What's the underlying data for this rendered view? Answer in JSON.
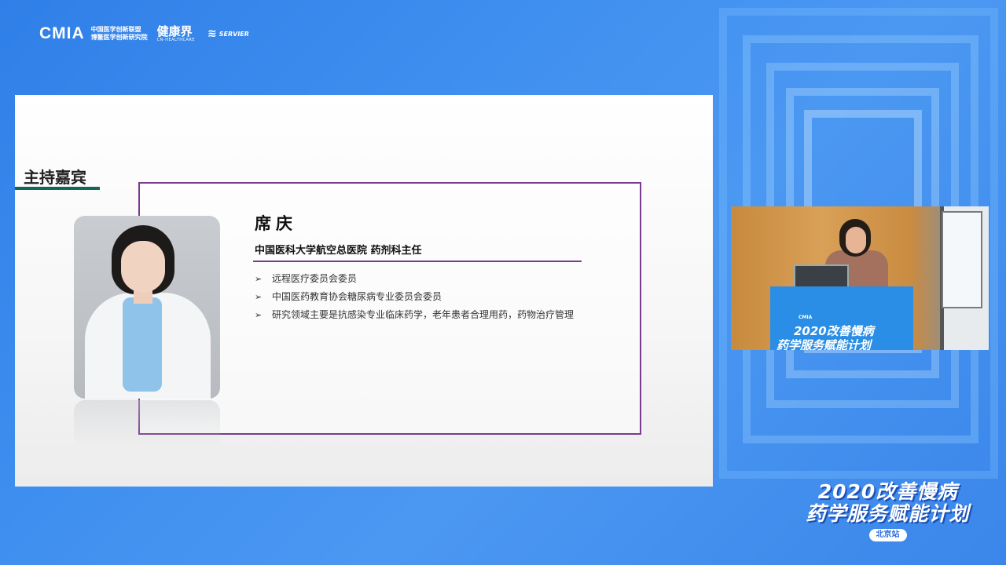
{
  "logos": {
    "cmia": "CMIA",
    "cmia_sub_line1": "中国医学创新联盟",
    "cmia_sub_line2": "博鳌医学创新研究院",
    "jkj_cn": "健康界",
    "jkj_en": "CN-HEALTHCARE",
    "servier": "SERVIER"
  },
  "slide": {
    "section_title": "主持嘉宾",
    "person": {
      "name": "席庆",
      "title": "中国医科大学航空总医院 药剂科主任",
      "bullets": [
        "远程医疗委员会委员",
        "中国医药教育协会糖尿病专业委员会委员",
        "研究领域主要是抗感染专业临床药学，老年患者合理用药，药物治疗管理"
      ]
    }
  },
  "webcam": {
    "podium_brand": "CMIA",
    "podium_line1": "2020改善慢病",
    "podium_line2": "药学服务赋能计划"
  },
  "event": {
    "line1": "2020改善慢病",
    "line2": "药学服务赋能计划",
    "city": "北京站"
  },
  "colors": {
    "background": "#3f8ff0",
    "accent_green": "#0c6b52",
    "accent_purple": "#7a3a8f"
  }
}
